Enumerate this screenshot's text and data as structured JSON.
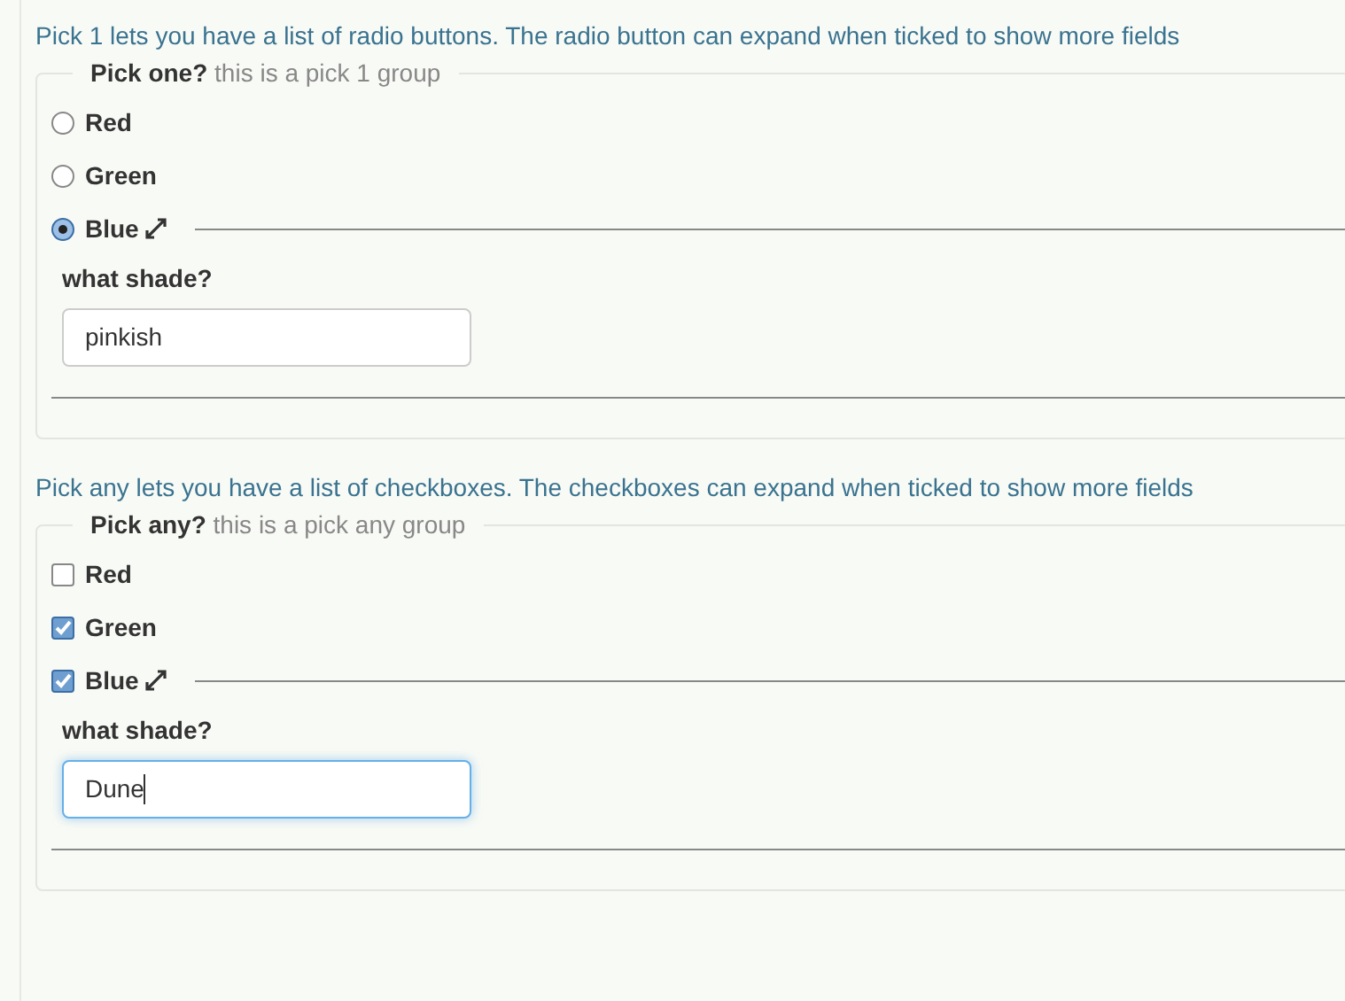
{
  "groups": [
    {
      "kind": "radio",
      "description": "Pick 1 lets you have a list of radio buttons. The radio button can expand when ticked to show more fields",
      "legend": {
        "title": "Pick one?",
        "hint": "this is a pick 1 group"
      },
      "options": [
        {
          "label": "Red",
          "selected": false,
          "expanded": false
        },
        {
          "label": "Green",
          "selected": false,
          "expanded": false
        },
        {
          "label": "Blue",
          "selected": true,
          "expanded": true,
          "field": {
            "label": "what shade?",
            "value": "pinkish",
            "focused": false
          }
        }
      ]
    },
    {
      "kind": "checkbox",
      "description": "Pick any lets you have a list of checkboxes. The checkboxes can expand when ticked to show more fields",
      "legend": {
        "title": "Pick any?",
        "hint": "this is a pick any group"
      },
      "options": [
        {
          "label": "Red",
          "checked": false,
          "expanded": false
        },
        {
          "label": "Green",
          "checked": true,
          "expanded": false
        },
        {
          "label": "Blue",
          "checked": true,
          "expanded": true,
          "field": {
            "label": "what shade?",
            "value": "Dune",
            "focused": true
          }
        }
      ]
    }
  ]
}
